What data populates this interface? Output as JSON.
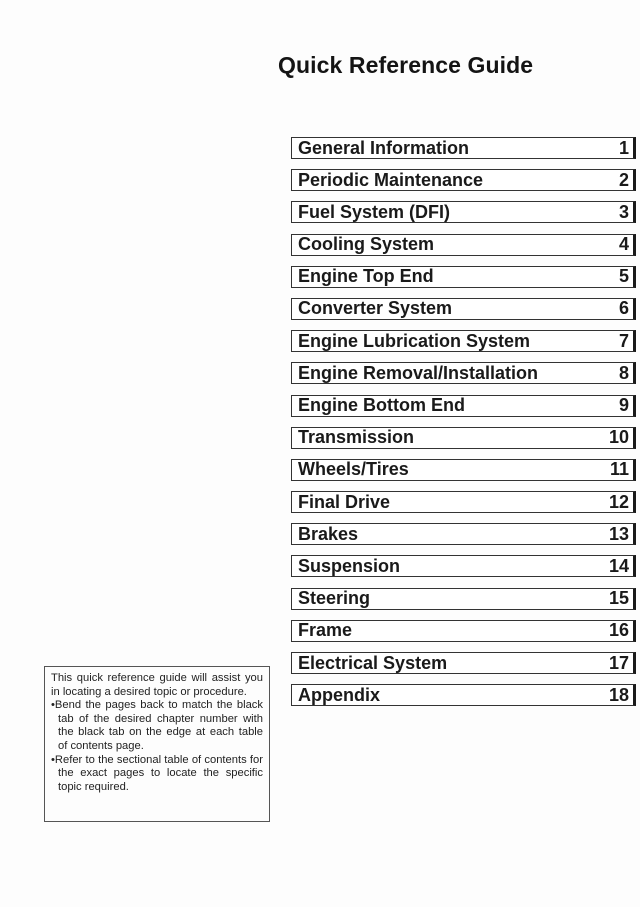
{
  "page": {
    "title": "Quick Reference Guide"
  },
  "toc": [
    {
      "label": "General Information",
      "chapter": "1"
    },
    {
      "label": "Periodic Maintenance",
      "chapter": "2"
    },
    {
      "label": "Fuel System (DFI)",
      "chapter": "3"
    },
    {
      "label": "Cooling System",
      "chapter": "4"
    },
    {
      "label": "Engine Top End",
      "chapter": "5"
    },
    {
      "label": "Converter System",
      "chapter": "6"
    },
    {
      "label": "Engine Lubrication System",
      "chapter": "7"
    },
    {
      "label": "Engine Removal/Installation",
      "chapter": "8"
    },
    {
      "label": "Engine Bottom End",
      "chapter": "9"
    },
    {
      "label": "Transmission",
      "chapter": "10"
    },
    {
      "label": "Wheels/Tires",
      "chapter": "11"
    },
    {
      "label": "Final Drive",
      "chapter": "12"
    },
    {
      "label": "Brakes",
      "chapter": "13"
    },
    {
      "label": "Suspension",
      "chapter": "14"
    },
    {
      "label": "Steering",
      "chapter": "15"
    },
    {
      "label": "Frame",
      "chapter": "16"
    },
    {
      "label": "Electrical System",
      "chapter": "17"
    },
    {
      "label": "Appendix",
      "chapter": "18"
    }
  ],
  "note": {
    "intro": "This quick reference guide will assist you in locating a desired topic or procedure.",
    "bullets": [
      "•Bend the pages back to match the black tab of the desired chapter number with the black tab on the edge at each table of contents page.",
      "•Refer to the sectional table of contents for the exact pages to locate the specific topic required."
    ]
  }
}
